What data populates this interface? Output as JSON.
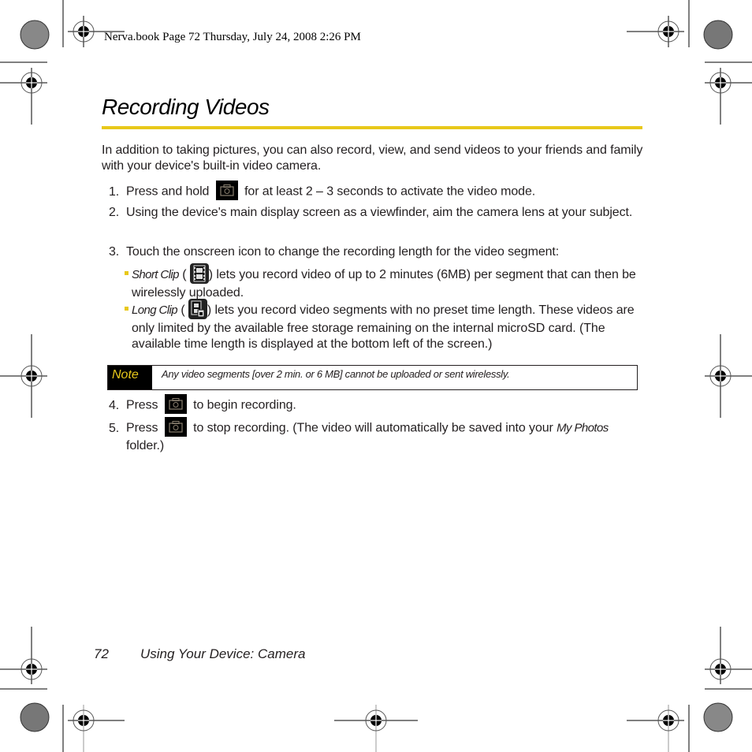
{
  "slug_line": "Nerva.book  Page 72  Thursday, July 24, 2008  2:26 PM",
  "title": "Recording Videos",
  "colors": {
    "accent": "#e8c81a",
    "note_bg": "#000000",
    "text": "#231f20"
  },
  "intro": "In addition to taking pictures, you can also record, view, and send videos to your friends and family with your device's built-in video camera.",
  "steps": [
    {
      "num": "1.",
      "before": "Press and hold",
      "icon": "camera-key-icon",
      "after": "for at least 2 – 3 seconds to activate the video mode."
    },
    {
      "num": "2.",
      "text": "Using the device's main display screen as a viewfinder, aim the camera lens at your subject."
    },
    {
      "num": "3.",
      "text": "Touch the onscreen icon to change the recording length for the video segment:"
    },
    {
      "num": "4.",
      "before": "Press",
      "icon": "camera-key-icon",
      "after": "to begin recording."
    },
    {
      "num": "5.",
      "before": "Press",
      "icon": "camera-key-icon",
      "after": "to stop recording. (The video will automatically be saved into your",
      "emph": "My Photos",
      "tail": "folder.)"
    }
  ],
  "bullets": [
    {
      "label": "Short Clip",
      "icon": "short-clip-icon",
      "text": ") lets you record video of up to 2 minutes (6MB) per segment that can then be wirelessly uploaded."
    },
    {
      "label": "Long Clip",
      "icon": "long-clip-icon",
      "text": ") lets you record video segments with no preset time length. These videos are only limited by the available free storage remaining on the internal microSD card. (The available time length is displayed at the bottom left of the screen.)"
    }
  ],
  "note": {
    "label": "Note",
    "text": "Any video segments [over 2 min. or 6 MB] cannot be uploaded or sent wirelessly."
  },
  "footer": {
    "page_number": "72",
    "section": "Using Your Device: Camera"
  }
}
